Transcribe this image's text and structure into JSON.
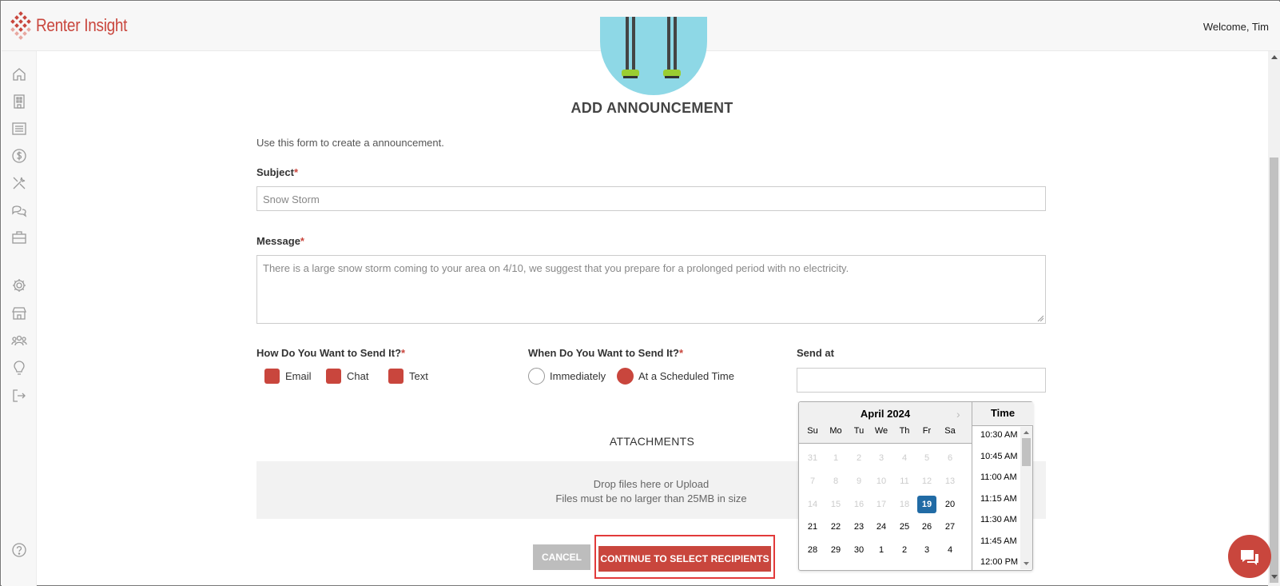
{
  "header": {
    "logo_text": "Renter Insight",
    "welcome": "Welcome, Tim"
  },
  "sidebar": {
    "items": [
      "home-icon",
      "building-icon",
      "list-icon",
      "dollar-icon",
      "tools-icon",
      "chat-icon",
      "briefcase-icon",
      "gear-icon",
      "store-icon",
      "people-icon",
      "lightbulb-icon",
      "logout-icon",
      "help-icon"
    ]
  },
  "form": {
    "title": "ADD ANNOUNCEMENT",
    "intro": "Use this form to create a announcement.",
    "subject_label": "Subject",
    "subject_value": "Snow Storm",
    "message_label": "Message",
    "message_value": "There is a large snow storm coming to your area on 4/10, we suggest that you prepare for a prolonged period with no electricity.",
    "required_mark": "*",
    "how_label": "How Do You Want to Send It?",
    "how_options": [
      "Email",
      "Chat",
      "Text"
    ],
    "when_label": "When Do You Want to Send It?",
    "when_options": [
      "Immediately",
      "At a Scheduled Time"
    ],
    "when_selected": "At a Scheduled Time",
    "send_at_label": "Send at",
    "send_at_value": "",
    "attachments_title": "ATTACHMENTS",
    "drop_line1": "Drop files here or Upload",
    "drop_line2": "Files must be no larger than 25MB in size",
    "cancel_label": "CANCEL",
    "continue_label": "CONTINUE TO SELECT RECIPIENTS"
  },
  "datepicker": {
    "month": "April 2024",
    "next_glyph": "›",
    "weekdays": [
      "Su",
      "Mo",
      "Tu",
      "We",
      "Th",
      "Fr",
      "Sa"
    ],
    "weeks": [
      [
        "31",
        "1",
        "2",
        "3",
        "4",
        "5",
        "6"
      ],
      [
        "7",
        "8",
        "9",
        "10",
        "11",
        "12",
        "13"
      ],
      [
        "14",
        "15",
        "16",
        "17",
        "18",
        "19",
        "20"
      ],
      [
        "21",
        "22",
        "23",
        "24",
        "25",
        "26",
        "27"
      ],
      [
        "28",
        "29",
        "30",
        "1",
        "2",
        "3",
        "4"
      ]
    ],
    "disabled_before": "19",
    "selected_day": "19",
    "time_title": "Time",
    "times": [
      "10:30 AM",
      "10:45 AM",
      "11:00 AM",
      "11:15 AM",
      "11:30 AM",
      "11:45 AM",
      "12:00 PM"
    ]
  },
  "colors": {
    "brand": "#c9463d",
    "selected_day": "#216ba5",
    "highlight_box": "#e23a3a"
  }
}
